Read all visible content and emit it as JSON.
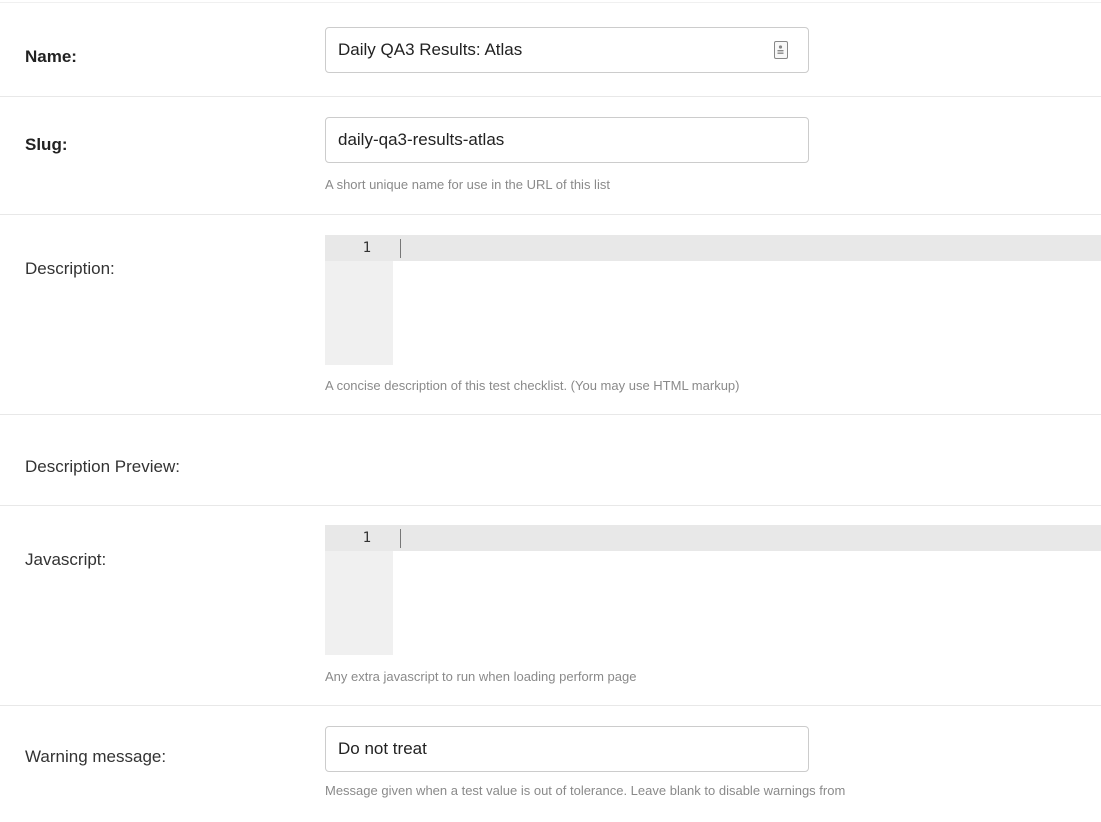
{
  "fields": {
    "name": {
      "label": "Name:",
      "value": "Daily QA3 Results: Atlas",
      "icon": "contact-card-icon"
    },
    "slug": {
      "label": "Slug:",
      "value": "daily-qa3-results-atlas",
      "help": "A short unique name for use in the URL of this list"
    },
    "description": {
      "label": "Description:",
      "line_number": "1",
      "help": "A concise description of this test checklist. (You may use HTML markup)"
    },
    "description_preview": {
      "label": "Description Preview:"
    },
    "javascript": {
      "label": "Javascript:",
      "line_number": "1",
      "help": "Any extra javascript to run when loading perform page"
    },
    "warning_message": {
      "label": "Warning message:",
      "value": "Do not treat",
      "help": "Message given when a test value is out of tolerance. Leave blank to disable warnings from"
    }
  }
}
